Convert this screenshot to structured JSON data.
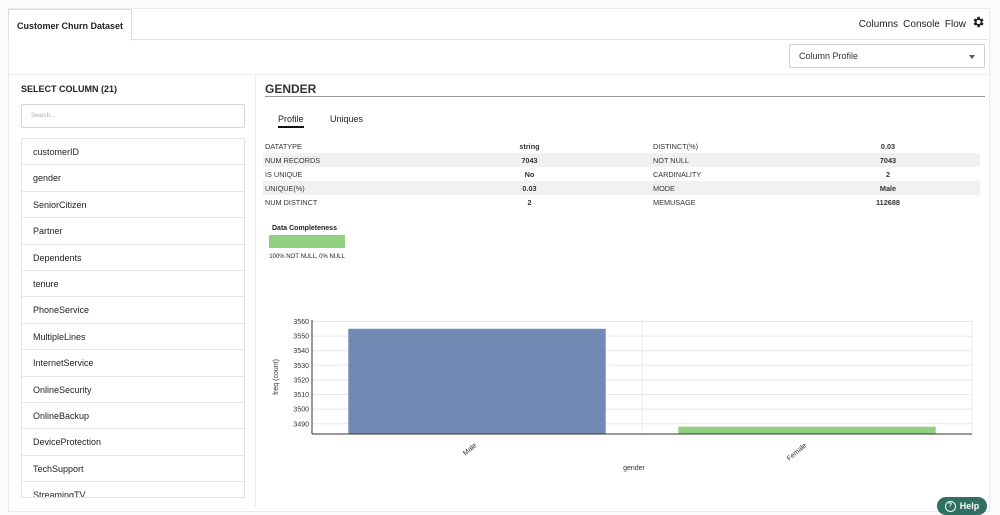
{
  "tabs": {
    "active": "Customer Churn Dataset"
  },
  "top_nav": [
    "Columns",
    "Console",
    "Flow"
  ],
  "view_select": {
    "value": "Column Profile"
  },
  "left": {
    "heading": "SELECT COLUMN (21)",
    "search_placeholder": "Search...",
    "columns": [
      "customerID",
      "gender",
      "SeniorCitizen",
      "Partner",
      "Dependents",
      "tenure",
      "PhoneService",
      "MultipleLines",
      "InternetService",
      "OnlineSecurity",
      "OnlineBackup",
      "DeviceProtection",
      "TechSupport",
      "StreamingTV"
    ]
  },
  "column_title": "GENDER",
  "profile_tabs": [
    "Profile",
    "Uniques"
  ],
  "stats": [
    {
      "label1": "DATATYPE",
      "value1": "string",
      "label2": "DISTINCT(%)",
      "value2": "0.03"
    },
    {
      "label1": "NUM RECORDS",
      "value1": "7043",
      "label2": "NOT NULL",
      "value2": "7043"
    },
    {
      "label1": "IS UNIQUE",
      "value1": "No",
      "label2": "CARDINALITY",
      "value2": "2"
    },
    {
      "label1": "UNIQUE(%)",
      "value1": "0.03",
      "label2": "MODE",
      "value2": "Male"
    },
    {
      "label1": "NUM DISTINCT",
      "value1": "2",
      "label2": "MEMUSAGE",
      "value2": "112688"
    }
  ],
  "completeness": {
    "title": "Data Completeness",
    "label": "100% NOT NULL, 0% NULL",
    "not_null_fraction": 1.0
  },
  "chart_data": {
    "type": "bar",
    "categories": [
      "Male",
      "Female"
    ],
    "values": [
      3555,
      3488
    ],
    "xlabel": "gender",
    "ylabel": "freq (count)",
    "yticks": [
      3490,
      3500,
      3510,
      3520,
      3530,
      3540,
      3550,
      3560
    ],
    "ylim": [
      3483,
      3561
    ],
    "colors": [
      "#7189b3",
      "#90d180"
    ],
    "grid": true
  },
  "help_label": "Help"
}
